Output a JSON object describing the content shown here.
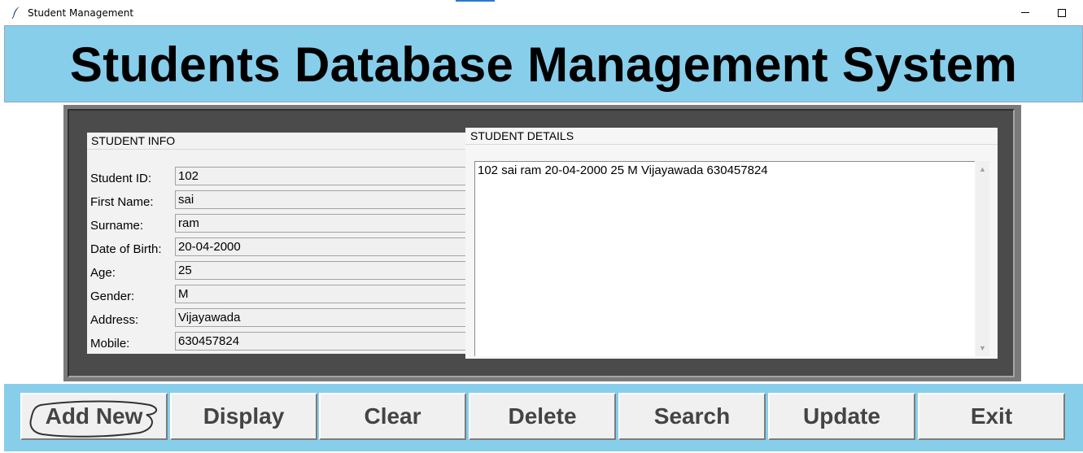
{
  "window": {
    "title": "Student Management",
    "icons": {
      "app": "feather-icon",
      "minimize": "minimize-icon",
      "maximize": "maximize-icon"
    }
  },
  "header": {
    "title": "Students Database Management System"
  },
  "student_info": {
    "title": "STUDENT INFO",
    "fields": [
      {
        "label": "Student ID:",
        "value": "102"
      },
      {
        "label": "First Name:",
        "value": "sai"
      },
      {
        "label": "Surname:",
        "value": "ram"
      },
      {
        "label": "Date of Birth:",
        "value": "20-04-2000"
      },
      {
        "label": "Age:",
        "value": "25"
      },
      {
        "label": "Gender:",
        "value": "M"
      },
      {
        "label": "Address:",
        "value": "Vijayawada"
      },
      {
        "label": "Mobile:",
        "value": "630457824"
      }
    ]
  },
  "student_details": {
    "title": "STUDENT DETAILS",
    "records": [
      "102 sai ram 20-04-2000 25 M Vijayawada 630457824"
    ]
  },
  "buttons": {
    "add_new": "Add New",
    "display": "Display",
    "clear": "Clear",
    "delete": "Delete",
    "search": "Search",
    "update": "Update",
    "exit": "Exit"
  },
  "colors": {
    "header_bg": "#87ceeb",
    "frame_dark": "#4b4b4b",
    "frame_border": "#7a7a7a",
    "button_bg": "#f0f0f0"
  }
}
